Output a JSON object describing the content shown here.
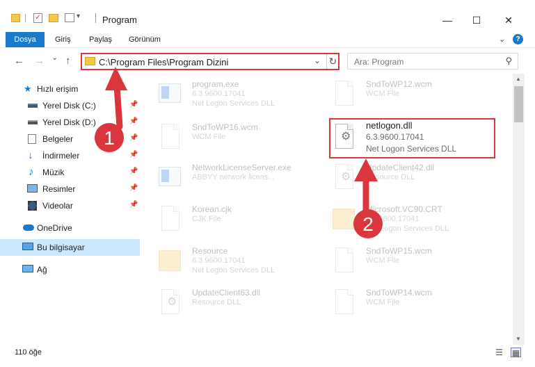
{
  "window": {
    "title": "Program",
    "minimize_glyph": "—",
    "maximize_glyph": "☐",
    "close_glyph": "✕"
  },
  "ribbon": {
    "file_tab": "Dosya",
    "tabs": [
      "Giriş",
      "Paylaş",
      "Görünüm"
    ],
    "expand_glyph": "⌄",
    "help_glyph": "?"
  },
  "nav": {
    "back_glyph": "←",
    "forward_glyph": "→",
    "recent_glyph": "⌄",
    "up_glyph": "↑",
    "address": "C:\\Program Files\\Program Dizini",
    "address_dropdown_glyph": "⌄",
    "refresh_glyph": "↻",
    "search_placeholder": "Ara: Program",
    "search_glyph": "⚲"
  },
  "sidebar": {
    "items": [
      {
        "label": "Hızlı erişim",
        "icon": "star-icon",
        "pinned": false
      },
      {
        "label": "Yerel Disk (C:)",
        "icon": "drive-icon",
        "pinned": true
      },
      {
        "label": "Yerel Disk (D:)",
        "icon": "drive-icon",
        "pinned": true
      },
      {
        "label": "Belgeler",
        "icon": "documents-icon",
        "pinned": true
      },
      {
        "label": "İndirmeler",
        "icon": "download-icon",
        "pinned": true
      },
      {
        "label": "Müzik",
        "icon": "music-icon",
        "pinned": true
      },
      {
        "label": "Resimler",
        "icon": "pictures-icon",
        "pinned": true
      },
      {
        "label": "Videolar",
        "icon": "videos-icon",
        "pinned": true
      },
      {
        "label": "OneDrive",
        "icon": "cloud-icon",
        "pinned": false
      },
      {
        "label": "Bu bilgisayar",
        "icon": "computer-icon",
        "pinned": false,
        "selected": true
      },
      {
        "label": "Ağ",
        "icon": "network-icon",
        "pinned": false
      }
    ],
    "pin_glyph": "📌"
  },
  "files": [
    {
      "name": "program.exe",
      "line2": "6.3.9600.17041",
      "line3": "Net Logon Services DLL",
      "icon": "exe"
    },
    {
      "name": "SndToWP12.wcm",
      "line2": "WCM File",
      "line3": "",
      "icon": "doc"
    },
    {
      "name": "SndToWP16.wcm",
      "line2": "WCM File",
      "line3": "",
      "icon": "doc"
    },
    {
      "name": "netlogon.dll",
      "line2": "6.3.9600.17041",
      "line3": "Net Logon Services DLL",
      "icon": "dll",
      "highlighted": true
    },
    {
      "name": "NetworkLicenseServer.exe",
      "line2": "ABBYY network licens...",
      "line3": "",
      "icon": "exe"
    },
    {
      "name": "UpdateClient42.dll",
      "line2": "Resource DLL",
      "line3": "",
      "icon": "dll"
    },
    {
      "name": "Korean.cjk",
      "line2": "CJK File",
      "line3": "",
      "icon": "doc"
    },
    {
      "name": "Microsoft.VC90.CRT",
      "line2": "6.3.9600.17041",
      "line3": "Net Logon Services DLL",
      "icon": "folder"
    },
    {
      "name": "Resource",
      "line2": "6.3.9600.17041",
      "line3": "Net Logon Services DLL",
      "icon": "folder"
    },
    {
      "name": "SndToWP15.wcm",
      "line2": "WCM File",
      "line3": "",
      "icon": "doc"
    },
    {
      "name": "UpdateClient63.dll",
      "line2": "Resource DLL",
      "line3": "",
      "icon": "dll"
    },
    {
      "name": "SndToWP14.wcm",
      "line2": "WCM File",
      "line3": "",
      "icon": "doc"
    }
  ],
  "status": {
    "item_count": "110 öğe"
  },
  "annotations": {
    "step1": "1",
    "step2": "2",
    "color": "#d9363e"
  }
}
